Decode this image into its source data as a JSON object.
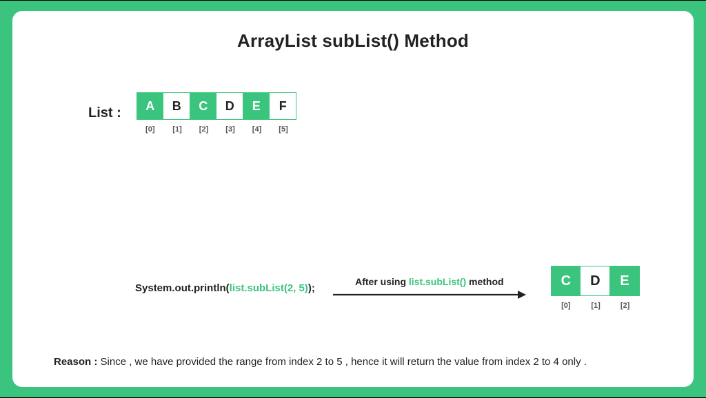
{
  "title": "ArrayList subList() Method",
  "list": {
    "label": "List :",
    "cells": [
      {
        "value": "A",
        "index": "[0]",
        "filled": true
      },
      {
        "value": "B",
        "index": "[1]",
        "filled": false
      },
      {
        "value": "C",
        "index": "[2]",
        "filled": true
      },
      {
        "value": "D",
        "index": "[3]",
        "filled": false
      },
      {
        "value": "E",
        "index": "[4]",
        "filled": true
      },
      {
        "value": "F",
        "index": "[5]",
        "filled": false
      }
    ]
  },
  "code": {
    "prefix": "System.out.println(",
    "highlight": "list.subList(2, 5)",
    "suffix": ");"
  },
  "arrow": {
    "caption_before": "After using ",
    "caption_highlight": "list.subList()",
    "caption_after": "  method"
  },
  "sublist": {
    "cells": [
      {
        "value": "C",
        "index": "[0]",
        "filled": true
      },
      {
        "value": "D",
        "index": "[1]",
        "filled": false
      },
      {
        "value": "E",
        "index": "[2]",
        "filled": true
      }
    ]
  },
  "reason": {
    "label": "Reason :",
    "text": " Since , we have provided the range from index 2 to 5 , hence it will return the value from index 2 to 4 only ."
  },
  "colors": {
    "accent": "#3ac47d"
  }
}
